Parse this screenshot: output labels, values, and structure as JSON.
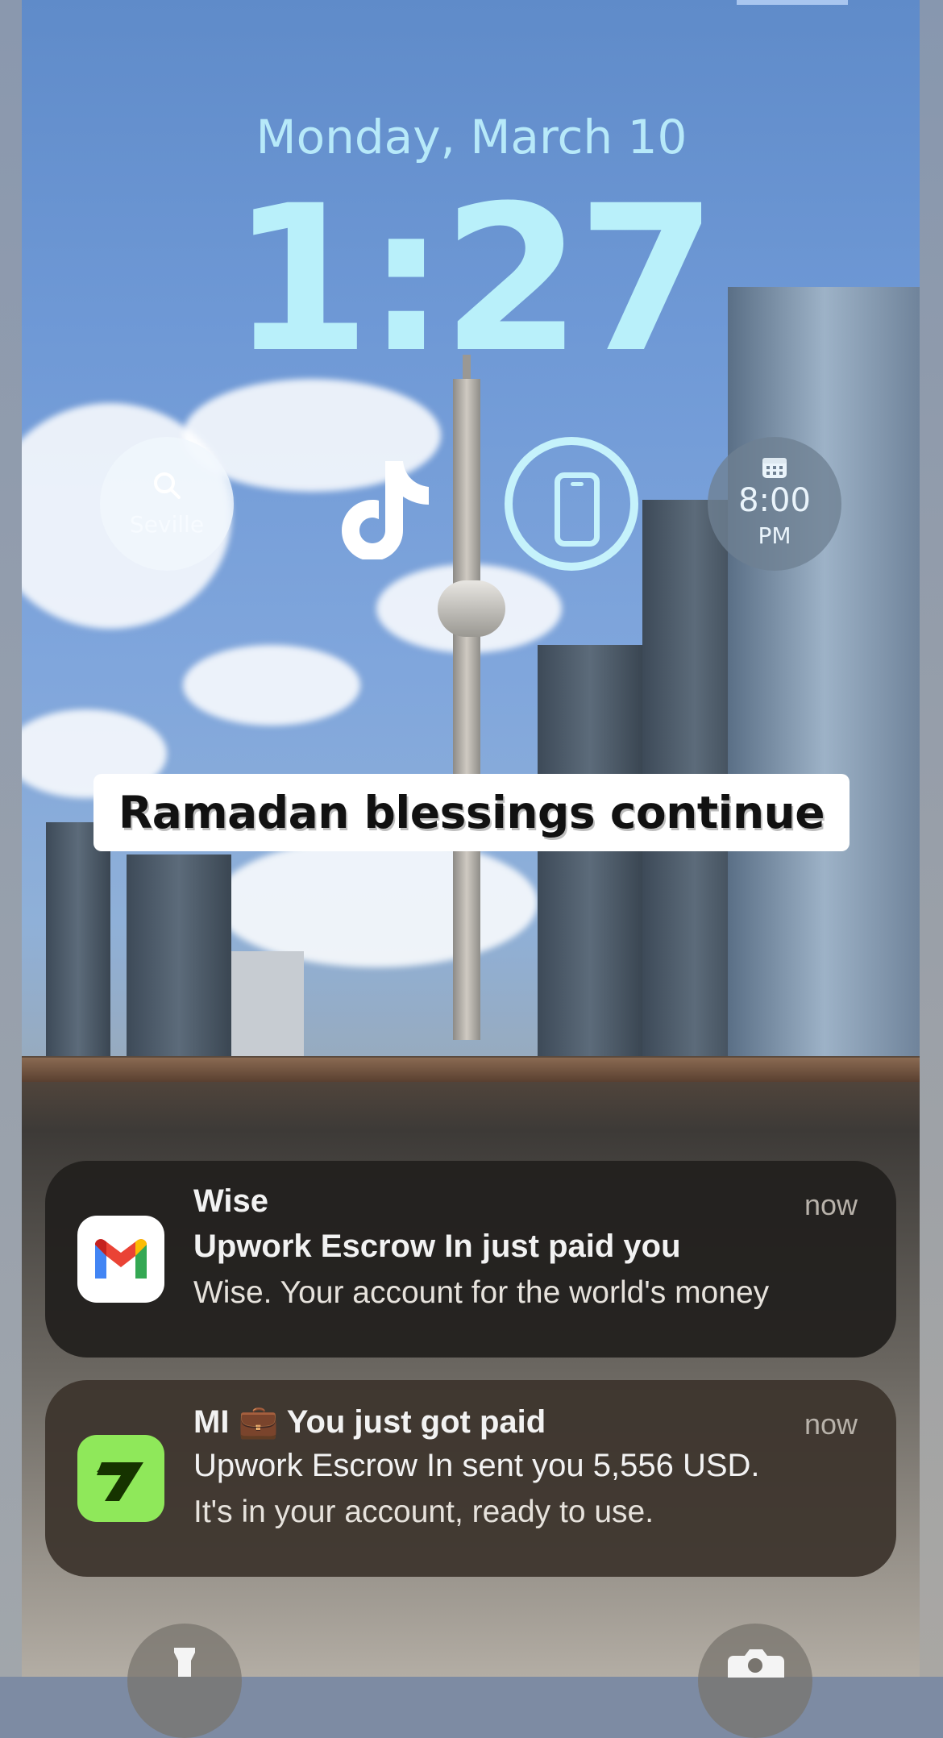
{
  "lockscreen": {
    "date": "Monday, March 10",
    "time": "1:27"
  },
  "widgets": {
    "weather": {
      "label": "Seville",
      "icon": "search-icon"
    },
    "tiktok": {
      "icon": "tiktok-icon"
    },
    "battery": {
      "icon": "phone-battery-icon"
    },
    "alarm": {
      "icon": "calendar-icon",
      "time": "8:00",
      "ampm": "PM"
    }
  },
  "banner": {
    "text": "Ramadan blessings continue"
  },
  "notifications": [
    {
      "app_icon": "gmail-icon",
      "title": "Wise",
      "timestamp": "now",
      "line1": "Upwork Escrow In just paid you",
      "line2": "Wise. Your account for the world's money"
    },
    {
      "app_icon": "wise-icon",
      "title": "MI 💼 You just got paid",
      "timestamp": "now",
      "line1": "Upwork Escrow In sent you 5,556 USD.",
      "line2": "It's in your account, ready to use."
    }
  ],
  "bottom_buttons": {
    "flashlight": {
      "icon": "flashlight-icon"
    },
    "camera": {
      "icon": "camera-icon"
    }
  },
  "colors": {
    "clock": "#b9f0fa",
    "wise_green": "#8fe85a",
    "notification_bg": "#26221e"
  }
}
